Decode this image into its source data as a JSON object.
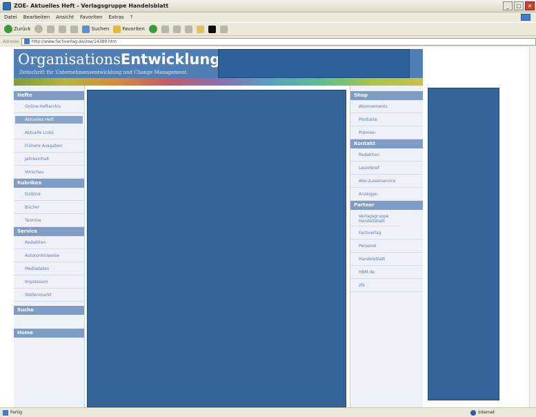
{
  "window": {
    "title": "ZOE- Aktuelles Heft - Verlagsgruppe Handelsblatt"
  },
  "menu": [
    "Datei",
    "Bearbeiten",
    "Ansicht",
    "Favoriten",
    "Extras",
    "?"
  ],
  "toolbar": {
    "back": "Zurück",
    "search": "Suchen",
    "favorites": "Favoriten"
  },
  "address": {
    "label": "Adresse",
    "url": "http://www.fachverlag.de/zoe/14389.htm"
  },
  "status": {
    "left": "Fertig",
    "zone": "Internet"
  },
  "header": {
    "logo_light": "Organisations",
    "logo_bold": "Entwicklung",
    "subtitle": "Zeitschrift für Unternehmensentwicklung und Change Management"
  },
  "left": {
    "hefte": {
      "title": "Hefte",
      "items": [
        "Online-Heftarchiv",
        "Aktuelles Heft",
        "Aktuelle Links",
        "Frühere Ausgaben",
        "Jahresinhalt",
        "Vorschau"
      ]
    },
    "rubriken": {
      "title": "Rubriken",
      "items": [
        "Einblick",
        "Bücher",
        "Termine"
      ]
    },
    "service": {
      "title": "Service",
      "items": [
        "Redaktion",
        "Autorenhinweise",
        "Mediadaten",
        "Impressum",
        "Stellenmarkt"
      ]
    },
    "suche": {
      "title": "Suche"
    },
    "home": {
      "title": "Home"
    }
  },
  "right": {
    "shop": {
      "title": "Shop",
      "items": [
        "Abonnements",
        "Produkte",
        "Prämien"
      ]
    },
    "kontakt": {
      "title": "Kontakt",
      "items": [
        "Redaktion",
        "Leserbrief",
        "Abo-/Leserservice",
        "Anzeigen"
      ]
    },
    "partner": {
      "title": "Partner",
      "items": [
        "Verlagsgruppe Handelsblatt",
        "Fachverlag",
        "Personal",
        "Handelsblatt",
        "HBM.de",
        "zfo"
      ]
    }
  }
}
